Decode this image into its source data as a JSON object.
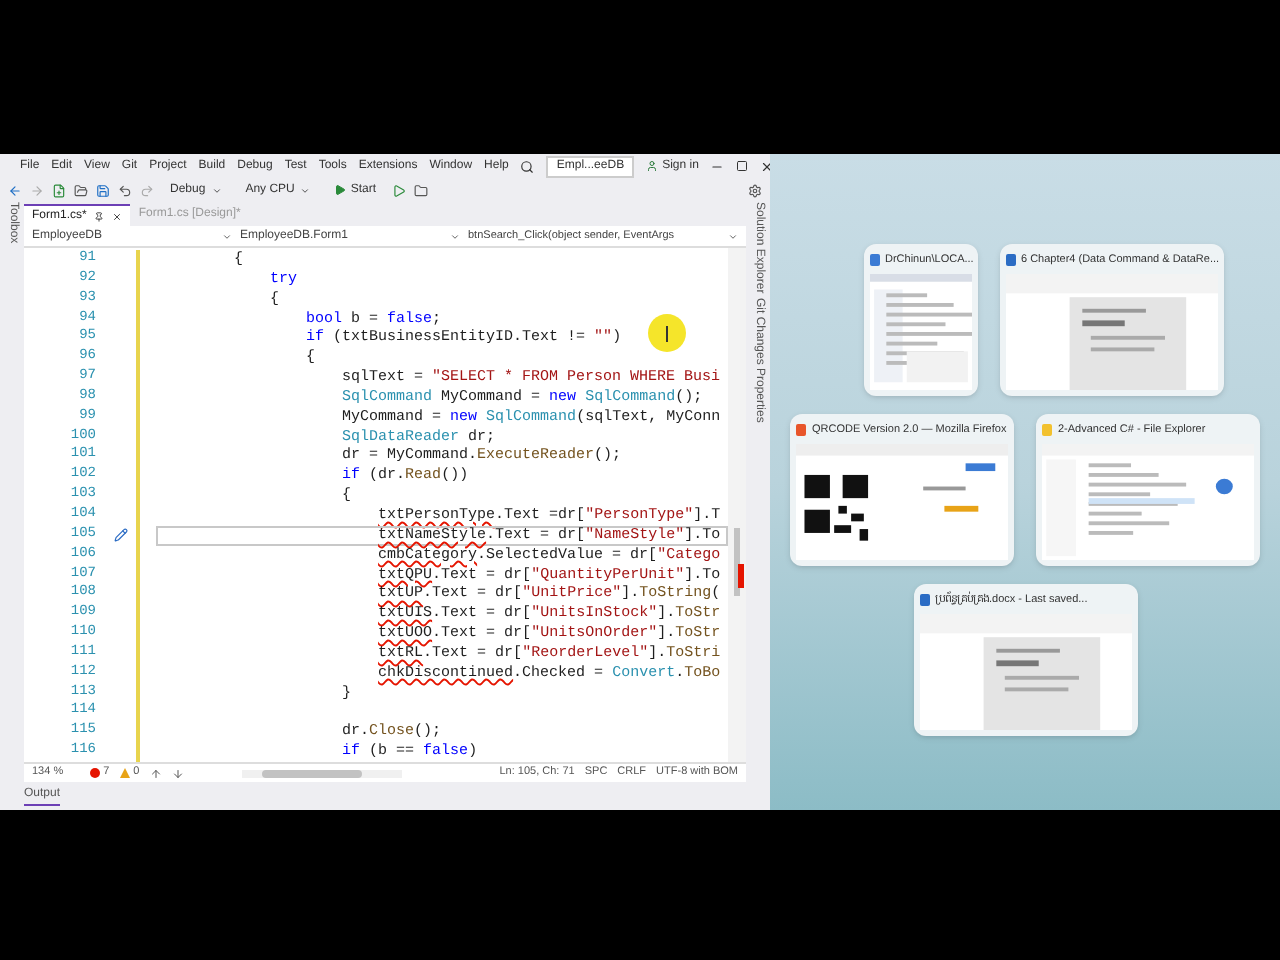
{
  "ide": {
    "menu": [
      "File",
      "Edit",
      "View",
      "Git",
      "Project",
      "Build",
      "Debug",
      "Test",
      "Tools",
      "Extensions",
      "Window",
      "Help"
    ],
    "solution_name": "Empl...eeDB",
    "sign_in": "Sign in",
    "toolbar": {
      "configuration": "Debug",
      "platform": "Any CPU",
      "start": "Start"
    },
    "left_strip": [
      "Toolbox"
    ],
    "right_strip": [
      "Solution Explorer",
      "Git Changes",
      "Properties"
    ],
    "tabs": [
      {
        "label": "Form1.cs*",
        "selected": true,
        "pinned": true
      },
      {
        "label": "Form1.cs [Design]*",
        "selected": false,
        "pinned": false
      }
    ],
    "nav": {
      "project": "EmployeeDB",
      "class": "EmployeeDB.Form1",
      "member": "btnSearch_Click(object sender, EventArgs"
    },
    "lines": [
      {
        "number": "91",
        "changed": true,
        "current": false,
        "tokens": [
          {
            "kind": "plain",
            "text": "        {"
          }
        ]
      },
      {
        "number": "92",
        "changed": true,
        "current": false,
        "tokens": [
          {
            "kind": "keyword",
            "text": "            try"
          }
        ]
      },
      {
        "number": "93",
        "changed": true,
        "current": false,
        "tokens": [
          {
            "kind": "plain",
            "text": "            {"
          }
        ]
      },
      {
        "number": "94",
        "changed": true,
        "current": false,
        "tokens": [
          {
            "kind": "keyword",
            "text": "                bool"
          },
          {
            "kind": "plain",
            "text": " b = "
          },
          {
            "kind": "keyword",
            "text": "false"
          },
          {
            "kind": "plain",
            "text": ";"
          }
        ]
      },
      {
        "number": "95",
        "changed": true,
        "current": false,
        "tokens": [
          {
            "kind": "keyword",
            "text": "                if"
          },
          {
            "kind": "plain",
            "text": " (txtBusinessEntityID.Text != "
          },
          {
            "kind": "string",
            "text": "\"\""
          },
          {
            "kind": "plain",
            "text": ")"
          }
        ]
      },
      {
        "number": "96",
        "changed": true,
        "current": false,
        "tokens": [
          {
            "kind": "plain",
            "text": "                {"
          }
        ]
      },
      {
        "number": "97",
        "changed": true,
        "current": false,
        "tokens": [
          {
            "kind": "plain",
            "text": "                    sqlText = "
          },
          {
            "kind": "string",
            "text": "\"SELECT * FROM Person WHERE Busi"
          }
        ]
      },
      {
        "number": "98",
        "changed": true,
        "current": false,
        "tokens": [
          {
            "kind": "type",
            "text": "                    SqlCommand"
          },
          {
            "kind": "plain",
            "text": " MyCommand = "
          },
          {
            "kind": "keyword",
            "text": "new "
          },
          {
            "kind": "type",
            "text": "SqlCommand"
          },
          {
            "kind": "plain",
            "text": "();"
          }
        ]
      },
      {
        "number": "99",
        "changed": true,
        "current": false,
        "tokens": [
          {
            "kind": "plain",
            "text": "                    MyCommand = "
          },
          {
            "kind": "keyword",
            "text": "new "
          },
          {
            "kind": "type",
            "text": "SqlCommand"
          },
          {
            "kind": "plain",
            "text": "(sqlText, MyConn"
          }
        ]
      },
      {
        "number": "100",
        "changed": true,
        "current": false,
        "tokens": [
          {
            "kind": "type",
            "text": "                    SqlDataReader"
          },
          {
            "kind": "plain",
            "text": " dr;"
          }
        ]
      },
      {
        "number": "101",
        "changed": true,
        "current": false,
        "tokens": [
          {
            "kind": "plain",
            "text": "                    dr = MyCommand."
          },
          {
            "kind": "method",
            "text": "ExecuteReader"
          },
          {
            "kind": "plain",
            "text": "();"
          }
        ]
      },
      {
        "number": "102",
        "changed": true,
        "current": false,
        "tokens": [
          {
            "kind": "keyword",
            "text": "                    if"
          },
          {
            "kind": "plain",
            "text": " (dr."
          },
          {
            "kind": "method",
            "text": "Read"
          },
          {
            "kind": "plain",
            "text": "())"
          }
        ]
      },
      {
        "number": "103",
        "changed": true,
        "current": false,
        "tokens": [
          {
            "kind": "plain",
            "text": "                    {"
          }
        ]
      },
      {
        "number": "104",
        "changed": true,
        "current": false,
        "tokens": [
          {
            "kind": "error",
            "text": "                        txtPersonType"
          },
          {
            "kind": "plain",
            "text": ".Text =dr["
          },
          {
            "kind": "string",
            "text": "\"PersonType\""
          },
          {
            "kind": "plain",
            "text": "].T"
          }
        ]
      },
      {
        "number": "105",
        "changed": true,
        "current": true,
        "tokens": [
          {
            "kind": "error",
            "text": "                        txtNameStyle"
          },
          {
            "kind": "plain",
            "text": ".Text = dr["
          },
          {
            "kind": "string",
            "text": "\"NameStyle\""
          },
          {
            "kind": "plain",
            "text": "].To"
          }
        ]
      },
      {
        "number": "106",
        "changed": true,
        "current": false,
        "tokens": [
          {
            "kind": "error",
            "text": "                        cmbCategory"
          },
          {
            "kind": "plain",
            "text": ".SelectedValue = dr["
          },
          {
            "kind": "string",
            "text": "\"Catego"
          }
        ]
      },
      {
        "number": "107",
        "changed": true,
        "current": false,
        "tokens": [
          {
            "kind": "error",
            "text": "                        txtQPU"
          },
          {
            "kind": "plain",
            "text": ".Text = dr["
          },
          {
            "kind": "string",
            "text": "\"QuantityPerUnit\""
          },
          {
            "kind": "plain",
            "text": "].To"
          }
        ]
      },
      {
        "number": "108",
        "changed": true,
        "current": false,
        "tokens": [
          {
            "kind": "error",
            "text": "                        txtUP"
          },
          {
            "kind": "plain",
            "text": ".Text = dr["
          },
          {
            "kind": "string",
            "text": "\"UnitPrice\""
          },
          {
            "kind": "plain",
            "text": "]."
          },
          {
            "kind": "method",
            "text": "ToString"
          },
          {
            "kind": "plain",
            "text": "("
          }
        ]
      },
      {
        "number": "109",
        "changed": true,
        "current": false,
        "tokens": [
          {
            "kind": "error",
            "text": "                        txtUIS"
          },
          {
            "kind": "plain",
            "text": ".Text = dr["
          },
          {
            "kind": "string",
            "text": "\"UnitsInStock\""
          },
          {
            "kind": "plain",
            "text": "]."
          },
          {
            "kind": "method",
            "text": "ToStr"
          }
        ]
      },
      {
        "number": "110",
        "changed": true,
        "current": false,
        "tokens": [
          {
            "kind": "error",
            "text": "                        txtUOO"
          },
          {
            "kind": "plain",
            "text": ".Text = dr["
          },
          {
            "kind": "string",
            "text": "\"UnitsOnOrder\""
          },
          {
            "kind": "plain",
            "text": "]."
          },
          {
            "kind": "method",
            "text": "ToStr"
          }
        ]
      },
      {
        "number": "111",
        "changed": true,
        "current": false,
        "tokens": [
          {
            "kind": "error",
            "text": "                        txtRL"
          },
          {
            "kind": "plain",
            "text": ".Text = dr["
          },
          {
            "kind": "string",
            "text": "\"ReorderLevel\""
          },
          {
            "kind": "plain",
            "text": "]."
          },
          {
            "kind": "method",
            "text": "ToStri"
          }
        ]
      },
      {
        "number": "112",
        "changed": true,
        "current": false,
        "tokens": [
          {
            "kind": "error",
            "text": "                        chkDiscontinued"
          },
          {
            "kind": "plain",
            "text": ".Checked = "
          },
          {
            "kind": "type",
            "text": "Convert"
          },
          {
            "kind": "plain",
            "text": "."
          },
          {
            "kind": "method",
            "text": "ToBo"
          }
        ]
      },
      {
        "number": "113",
        "changed": true,
        "current": false,
        "tokens": [
          {
            "kind": "plain",
            "text": "                    }"
          }
        ]
      },
      {
        "number": "114",
        "changed": true,
        "current": false
      },
      {
        "number": "115",
        "changed": true,
        "current": false,
        "tokens": [
          {
            "kind": "plain",
            "text": "                    dr."
          },
          {
            "kind": "method",
            "text": "Close"
          },
          {
            "kind": "plain",
            "text": "();"
          }
        ]
      },
      {
        "number": "116",
        "changed": true,
        "current": false,
        "tokens": [
          {
            "kind": "keyword",
            "text": "                    if"
          },
          {
            "kind": "plain",
            "text": " (b == "
          },
          {
            "kind": "keyword",
            "text": "false"
          },
          {
            "kind": "plain",
            "text": ")"
          }
        ]
      }
    ],
    "status": {
      "zoom": "134 %",
      "errors": "7",
      "warnings": "0",
      "position": "Ln: 105, Ch: 71",
      "indent": "SPC",
      "line_endings": "CRLF",
      "encoding": "UTF-8 with BOM"
    },
    "bottom_tabs": [
      "Output"
    ]
  },
  "snap_windows": [
    {
      "kind": "database",
      "title": "DrChinun\\LOCA...",
      "color": "#3b7bd4"
    },
    {
      "kind": "document",
      "title": "6 Chapter4 (Data Command & DataRe...",
      "color": "#2b6cc4"
    },
    {
      "kind": "browser",
      "title": "QRCODE Version 2.0 — Mozilla Firefox",
      "color": "#e8552a"
    },
    {
      "kind": "explorer",
      "title": "2-Advanced C# - File Explorer",
      "color": "#f2c12e"
    },
    {
      "kind": "document",
      "title": "ប្រព័ន្ធគ្រប់គ្រង.docx - Last saved...",
      "color": "#2b6cc4"
    }
  ]
}
